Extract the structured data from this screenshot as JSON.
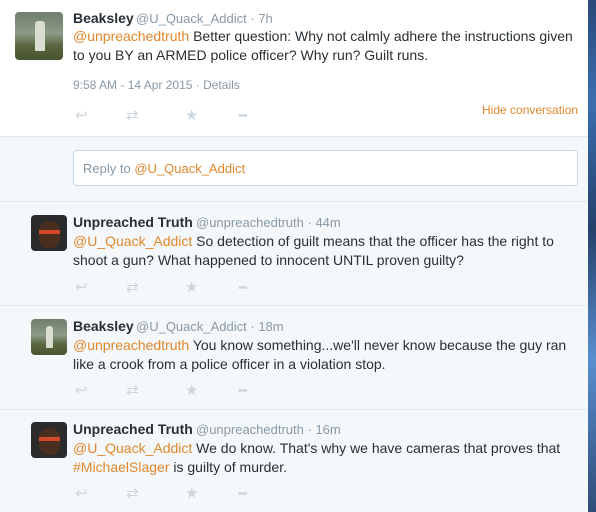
{
  "focus_tweet": {
    "name": "Beaksley",
    "handle": "@U_Quack_Addict",
    "age": "· 7h",
    "mention": "@unpreachedtruth",
    "text_line1": " Better question: Why not calmly adhere the instructions given",
    "text_line2": "to you BY an ARMED police officer? Why run? Guilt runs.",
    "timestamp": "9:58 AM - 14 Apr 2015",
    "details_link": "· Details",
    "hide_conversation": "Hide conversation"
  },
  "reply_box": {
    "prefix": "Reply to ",
    "mention": "@U_Quack_Addict"
  },
  "replies": [
    {
      "name": "Unpreached Truth",
      "handle": "@unpreachedtruth",
      "age": "· 44m",
      "mention": "@U_Quack_Addict",
      "line1": " So detection of guilt means that the officer has the right to",
      "line2": "shoot a gun? What happened to innocent UNTIL proven guilty?"
    },
    {
      "name": "Beaksley",
      "handle": "@U_Quack_Addict",
      "age": "· 18m",
      "mention": "@unpreachedtruth",
      "line1": " You know something...we'll never know because the guy ran",
      "line2": "like a crook from a police officer in a violation stop."
    },
    {
      "name": "Unpreached Truth",
      "handle": "@unpreachedtruth",
      "age": "· 16m",
      "mention": "@U_Quack_Addict",
      "line1": " We do know. That's why we have cameras that proves that",
      "hashtag": "#MichaelSlager",
      "line2": " is guilty of murder."
    }
  ],
  "action_icons": {
    "reply": "↩",
    "retweet": "⇄",
    "favorite": "★",
    "more": "•••"
  },
  "colors": {
    "accent": "#e0872b",
    "text": "#292f33",
    "muted": "#8899a6",
    "icon": "#ccd6dd",
    "panel_bg": "#f5f8fa"
  }
}
